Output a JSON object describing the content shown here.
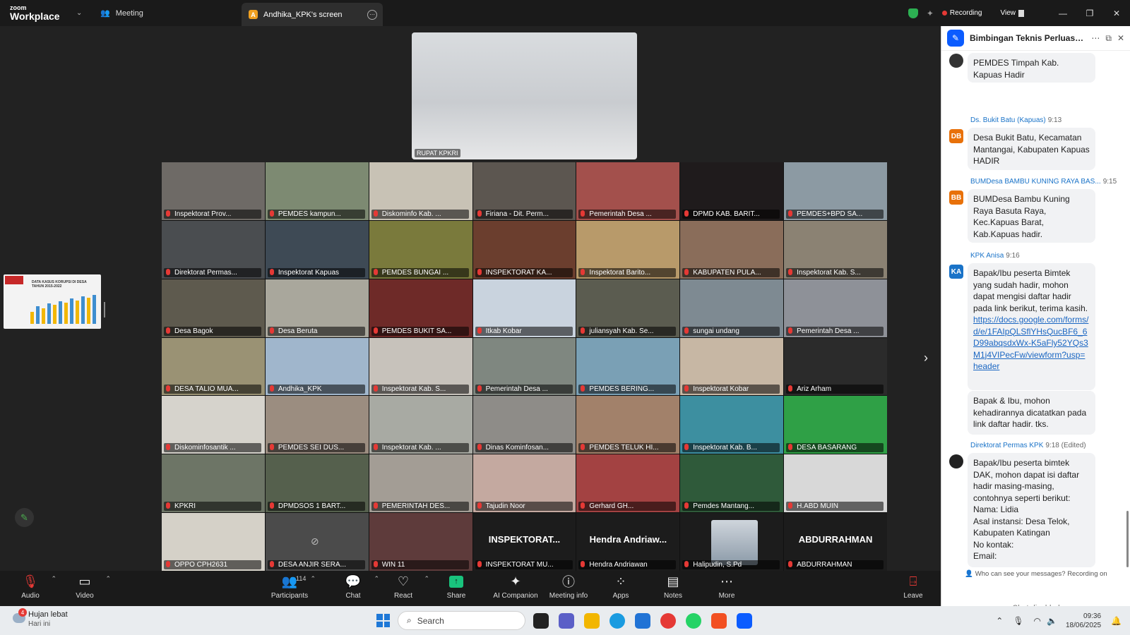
{
  "titlebar": {
    "logo_line1": "zoom",
    "logo_line2": "Workplace",
    "meeting_tab": "Meeting",
    "screen_tab": "Andhika_KPK's screen",
    "screen_badge": "A",
    "recording": "Recording",
    "view": "View"
  },
  "active_speaker": {
    "name": "RUPAT KPKRI"
  },
  "share_thumb": {
    "title": "DATA KASUS KORUPSI DI DESA TAHUN 2015-2022"
  },
  "grid": {
    "tiles": [
      {
        "name": "Inspektorat Prov...",
        "bg": "#6e6a66"
      },
      {
        "name": "PEMDES kampun...",
        "bg": "#7d8a72"
      },
      {
        "name": "Diskominfo Kab. ...",
        "bg": "#c8c2b5"
      },
      {
        "name": "Firiana - Dit. Perm...",
        "bg": "#5c5650"
      },
      {
        "name": "Pemerintah Desa ...",
        "bg": "#a3504c"
      },
      {
        "name": "DPMD KAB. BARIT...",
        "bg": "#1f1b1c"
      },
      {
        "name": "PEMDES+BPD SA...",
        "bg": "#8c9aa3"
      },
      {
        "name": "Direktorat Permas...",
        "bg": "#4a4d50"
      },
      {
        "name": "Inspektorat Kapuas",
        "bg": "#3e4a55"
      },
      {
        "name": "PEMDES BUNGAI ...",
        "bg": "#7a7a3c"
      },
      {
        "name": "INSPEKTORAT KA...",
        "bg": "#6b3e2e"
      },
      {
        "name": "Inspektorat Barito...",
        "bg": "#b89a6a"
      },
      {
        "name": "KABUPATEN PULA...",
        "bg": "#8a6d5a"
      },
      {
        "name": "Inspektorat Kab. S...",
        "bg": "#8b8273"
      },
      {
        "name": "Desa Bagok",
        "bg": "#5e5a4e"
      },
      {
        "name": "Desa Beruta",
        "bg": "#a9a79c"
      },
      {
        "name": "PEMDES BUKIT SA...",
        "bg": "#6e2a28"
      },
      {
        "name": "Itkab Kobar",
        "bg": "#c9d3de"
      },
      {
        "name": "juliansyah Kab. Se...",
        "bg": "#5b5c50"
      },
      {
        "name": "sungai undang",
        "bg": "#7e8a92"
      },
      {
        "name": "Pemerintah Desa ...",
        "bg": "#8e9198"
      },
      {
        "name": "DESA TALIO MUA...",
        "bg": "#9a9274"
      },
      {
        "name": "Andhika_KPK",
        "bg": "#a0b6cc"
      },
      {
        "name": "Inspektorat Kab. S...",
        "bg": "#c7c2bb"
      },
      {
        "name": "Pemerintah Desa ...",
        "bg": "#7f8780"
      },
      {
        "name": "PEMDES BERING...",
        "bg": "#7aa0b5"
      },
      {
        "name": "Inspektorat Kobar",
        "bg": "#c7b7a4"
      },
      {
        "name": "Ariz Arham",
        "bg": "#2b2b2b"
      },
      {
        "name": "Diskominfosantik ...",
        "bg": "#d6d3cc"
      },
      {
        "name": "PEMDES SEI DUS...",
        "bg": "#9b8d80"
      },
      {
        "name": "Inspektorat Kab. ...",
        "bg": "#a8aaa3"
      },
      {
        "name": "Dinas Kominfosan...",
        "bg": "#8e8c88"
      },
      {
        "name": "PEMDES TELUK HI...",
        "bg": "#a2816a"
      },
      {
        "name": "Inspektorat Kab. B...",
        "bg": "#3d8fa0"
      },
      {
        "name": "DESA BASARANG",
        "bg": "#2fa046"
      },
      {
        "name": "KPKRI",
        "bg": "#6d7566"
      },
      {
        "name": "DPMDSOS 1 BART...",
        "bg": "#55604d"
      },
      {
        "name": "PEMERINTAH DES...",
        "bg": "#a39d95"
      },
      {
        "name": "Tajudin Noor",
        "bg": "#c4a9a0"
      },
      {
        "name": "Gerhard GH...",
        "bg": "#a34242"
      },
      {
        "name": "Pemdes Mantang...",
        "bg": "#2f5a3a"
      },
      {
        "name": "H.ABD MUIN",
        "bg": "#d8d8d8"
      },
      {
        "name": "OPPO CPH2631",
        "bg": "#d5d1c8"
      },
      {
        "name": "DESA ANJIR SERA...",
        "bg": "#4b4b4b",
        "cam_off": true
      },
      {
        "name": "WIN 11",
        "bg": "#5e3b3b"
      },
      {
        "name": "INSPEKTORAT MU...",
        "bg": "#1c1c1c",
        "big": "INSPEKTORAT..."
      },
      {
        "name": "Hendra Andriawan",
        "bg": "#1c1c1c",
        "big": "Hendra Andriaw..."
      },
      {
        "name": "Halipudin, S.Pd",
        "bg": "#1c1c1c",
        "avatar": true
      },
      {
        "name": "ABDURRAHMAN",
        "bg": "#1c1c1c",
        "big": "ABDURRAHMAN"
      }
    ]
  },
  "chat": {
    "title": "Bimbingan Teknis Perluasan...",
    "messages": [
      {
        "sender": "",
        "time": "",
        "initials": "",
        "av_color": "#333",
        "text": "PEMDES Timpah Kab. Kapuas Hadir",
        "link": ""
      },
      {
        "sender": "Ds. Bukit Batu (Kapuas)",
        "time": "9:13",
        "initials": "DB",
        "av_color": "#e8710a",
        "text": "Desa Bukit Batu, Kecamatan Mantangai, Kabupaten Kapuas HADIR",
        "link": ""
      },
      {
        "sender": "BUMDesa BAMBU KUNING RAYA BAS...",
        "time": "9:15",
        "initials": "BB",
        "av_color": "#e8710a",
        "text": "BUMDesa Bambu Kuning Raya Basuta Raya, Kec.Kapuas Barat, Kab.Kapuas hadir.",
        "link": ""
      },
      {
        "sender": "KPK Anisa",
        "time": "9:16",
        "initials": "KA",
        "av_color": "#1a73c8",
        "text": "Bapak/Ibu peserta Bimtek yang sudah hadir, mohon dapat mengisi daftar hadir pada link berikut, terima kasih.",
        "link": "https://docs.google.com/forms/d/e/1FAIpQLSflYHsQucBF6_6D99abqsdxWx-K5aFly52YQs3M1j4VIPecFw/viewform?usp=header"
      },
      {
        "sender": "",
        "time": "",
        "initials": "",
        "av_color": "",
        "text": "Bapak & Ibu, mohon kehadirannya dicatatkan pada link daftar hadir. tks.",
        "link": ""
      },
      {
        "sender": "Direktorat Permas KPK",
        "time": "9:18 (Edited)",
        "initials": "",
        "av_color": "#222",
        "text": "Bapak/Ibu peserta bimtek DAK, mohon dapat isi daftar hadir masing-masing, contohnya seperti berikut:\nNama: Lidia\nAsal instansi: Desa Telok, Kabupaten Katingan\nNo kontak:\nEmail:",
        "link": ""
      }
    ],
    "who_can_see": "Who can see your messages? Recording on",
    "disabled": "Chat disabled"
  },
  "toolbar": {
    "audio": "Audio",
    "video": "Video",
    "participants": "Participants",
    "participants_count": "114",
    "chat": "Chat",
    "react": "React",
    "share": "Share",
    "ai": "AI Companion",
    "info": "Meeting info",
    "apps": "Apps",
    "notes": "Notes",
    "more": "More",
    "leave": "Leave"
  },
  "taskbar": {
    "weather_badge": "4",
    "weather_title": "Hujan lebat",
    "weather_sub": "Hari ini",
    "search": "Search",
    "time": "09:36",
    "date": "18/06/2025"
  }
}
